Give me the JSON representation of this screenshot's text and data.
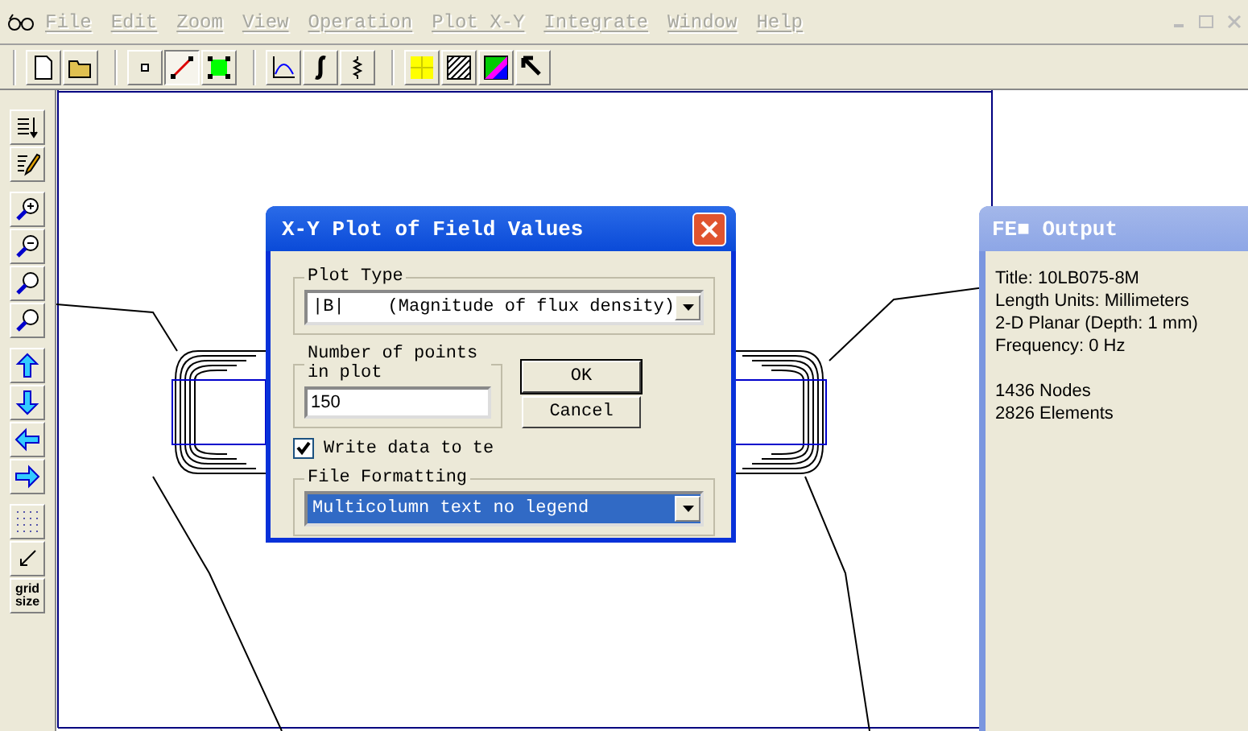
{
  "menu": [
    {
      "label": "File",
      "disabled": true
    },
    {
      "label": "Edit",
      "disabled": true
    },
    {
      "label": "Zoom",
      "disabled": true
    },
    {
      "label": "View",
      "disabled": true
    },
    {
      "label": "Operation",
      "disabled": true
    },
    {
      "label": "Plot X-Y",
      "disabled": true
    },
    {
      "label": "Integrate",
      "disabled": true
    },
    {
      "label": "Window",
      "disabled": true
    },
    {
      "label": "Help",
      "disabled": true
    }
  ],
  "toolbar": [
    [
      {
        "kind": "new",
        "selected": false
      },
      {
        "kind": "open",
        "selected": false
      }
    ],
    [
      {
        "kind": "point",
        "selected": false
      },
      {
        "kind": "segment",
        "selected": true
      },
      {
        "kind": "block",
        "selected": false
      }
    ],
    [
      {
        "kind": "plot",
        "selected": false
      },
      {
        "kind": "integral",
        "selected": false
      },
      {
        "kind": "coil",
        "selected": false
      }
    ],
    [
      {
        "kind": "grid",
        "selected": false
      },
      {
        "kind": "hatch",
        "selected": false
      },
      {
        "kind": "density",
        "selected": false
      },
      {
        "kind": "pointer",
        "selected": false
      }
    ]
  ],
  "side_toolbar": [
    [
      {
        "kind": "list"
      },
      {
        "kind": "edit"
      }
    ],
    [
      {
        "kind": "zoom-in"
      },
      {
        "kind": "zoom-out"
      },
      {
        "kind": "zoom-fit"
      },
      {
        "kind": "zoom-window"
      }
    ],
    [
      {
        "kind": "up"
      },
      {
        "kind": "down"
      },
      {
        "kind": "left"
      },
      {
        "kind": "right"
      }
    ],
    [
      {
        "kind": "dots"
      },
      {
        "kind": "snap"
      },
      {
        "kind": "text",
        "label": "grid\nsize"
      }
    ]
  ],
  "dialog": {
    "title": "X-Y Plot of Field Values",
    "plot_type": {
      "legend": "Plot Type",
      "symbol": "|B|",
      "value": "(Magnitude of flux density)"
    },
    "points": {
      "legend": "Number of points in plot",
      "value": "150"
    },
    "ok": "OK",
    "cancel": "Cancel",
    "write": {
      "label": "Write  data to te",
      "checked": true
    },
    "file_formatting": {
      "legend": "File Formatting",
      "value": "Multicolumn text no legend",
      "selected": true
    }
  },
  "output": {
    "title": "FE■ Output",
    "lines": [
      "Title: 10LB075-8M",
      "Length Units: Millimeters",
      "2-D Planar (Depth: 1 mm)",
      "Frequency: 0 Hz"
    ],
    "counts": [
      "1436 Nodes",
      "2826 Elements"
    ]
  }
}
